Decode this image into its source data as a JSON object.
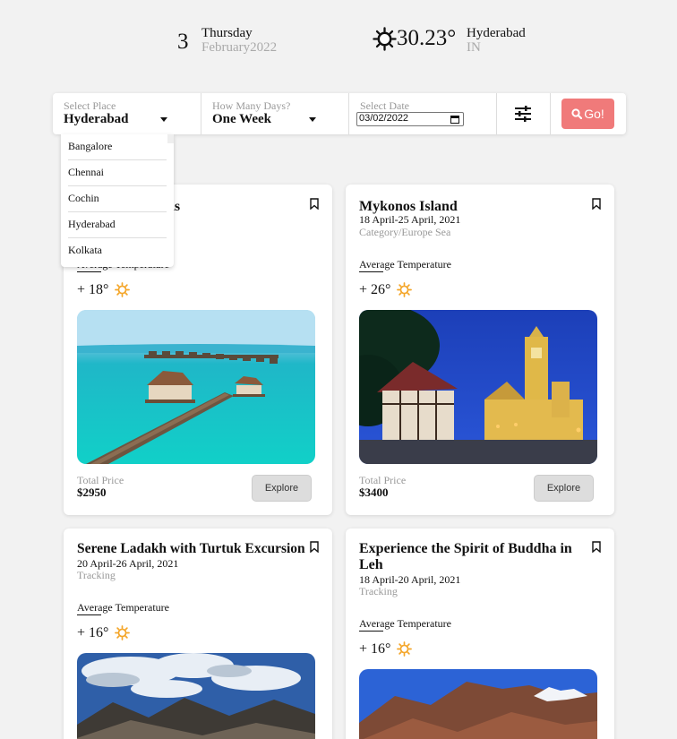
{
  "header": {
    "day_number": "3",
    "day_name": "Thursday",
    "month_year": "February2022",
    "temperature": "30.23°",
    "city": "Hyderabad",
    "country": "IN"
  },
  "search": {
    "place_label": "Select Place",
    "place_value": "Hyderabad",
    "days_label": "How Many Days?",
    "days_value": "One Week",
    "date_label": "Select Date",
    "date_value": "03/02/2022",
    "go_label": "Go!"
  },
  "place_options": [
    "Bangalore",
    "Chennai",
    "Cochin",
    "Hyderabad",
    "Kolkata"
  ],
  "cards": [
    {
      "title": "Maldives Islands",
      "dates": "",
      "category": "",
      "avg_label": "Average Temperature",
      "temp": "+ 18°",
      "price_label": "Total Price",
      "price": "$2950",
      "explore_label": "Explore"
    },
    {
      "title": "Mykonos Island",
      "dates": "18 April-25 April, 2021",
      "category": "Category/Europe Sea",
      "avg_label": "Average Temperature",
      "temp": "+ 26°",
      "price_label": "Total Price",
      "price": "$3400",
      "explore_label": "Explore"
    },
    {
      "title": "Serene Ladakh with Turtuk Excursion",
      "dates": "20 April-26 April, 2021",
      "category": "Tracking",
      "avg_label": "Average Temperature",
      "temp": "+ 16°"
    },
    {
      "title": "Experience the Spirit of Buddha in Leh",
      "dates": "18 April-20 April, 2021",
      "category": "Tracking",
      "avg_label": "Average Temperature",
      "temp": "+ 16°"
    }
  ],
  "colors": {
    "go_button": "#f07a7a",
    "sun_icon": "#f4a62a",
    "background": "#f2f2f2"
  }
}
